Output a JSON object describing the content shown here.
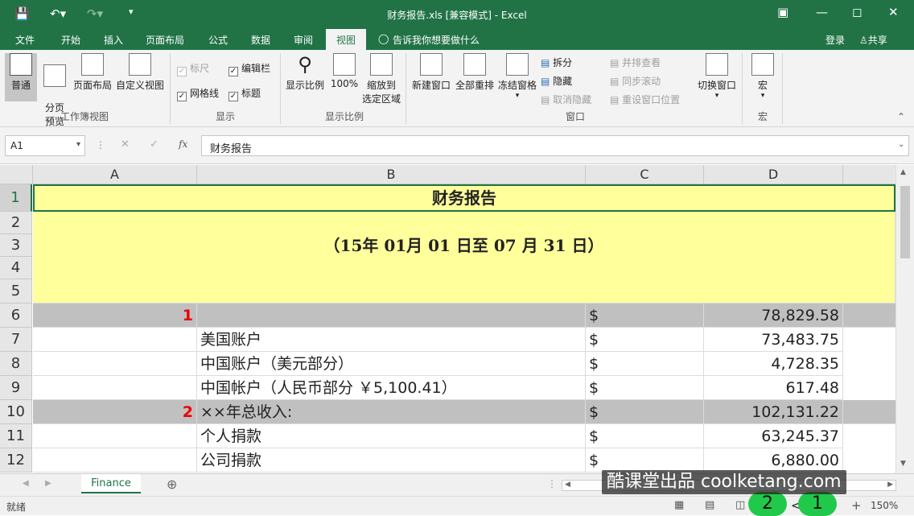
{
  "window": {
    "title": "财务报告.xls [兼容模式] - Excel",
    "qat": {
      "save_icon": "save-icon",
      "undo_icon": "undo-icon",
      "redo_icon": "redo-icon",
      "customize_icon": "customize-icon"
    },
    "controls": [
      "restore-ribbon-icon",
      "minimize-icon",
      "maximize-icon",
      "close-icon"
    ]
  },
  "tabs": {
    "file": "文件",
    "home": "开始",
    "insert": "插入",
    "layout": "页面布局",
    "formulas": "公式",
    "data": "数据",
    "review": "审阅",
    "view": "视图",
    "tell_me": "告诉我你想要做什么",
    "login": "登录",
    "share": "共享"
  },
  "ribbon": {
    "workbook_views": {
      "group": "工作簿视图",
      "normal": "普通",
      "page_break": "分页\n预览",
      "page_layout": "页面布局",
      "custom": "自定义视图"
    },
    "show": {
      "group": "显示",
      "ruler": "标尺",
      "gridlines": "网格线",
      "formula_bar": "编辑栏",
      "headings": "标题"
    },
    "zoom": {
      "group": "显示比例",
      "zoom": "显示比例",
      "hundred": "100%",
      "zoom_selection_1": "缩放到",
      "zoom_selection_2": "选定区域"
    },
    "window": {
      "group": "窗口",
      "new_window": "新建窗口",
      "arrange_all": "全部重排",
      "freeze": "冻结窗格",
      "split": "拆分",
      "hide": "隐藏",
      "unhide": "取消隐藏",
      "side_by_side": "并排查看",
      "sync_scroll": "同步滚动",
      "reset_pos": "重设窗口位置",
      "switch": "切换窗口"
    },
    "macros": {
      "group": "宏",
      "macros": "宏"
    }
  },
  "formula_bar": {
    "name_box": "A1",
    "fx": "fx",
    "content": "财务报告"
  },
  "grid": {
    "columns": [
      "A",
      "B",
      "C",
      "D"
    ],
    "rows": [
      "1",
      "2",
      "3",
      "4",
      "5",
      "6",
      "7",
      "8",
      "9",
      "10",
      "11",
      "12"
    ],
    "title": "财务报告",
    "date_range": "（15年  01月  01  日至  07  月  31  日）",
    "r6": {
      "a": "1",
      "c": "$",
      "d": "78,829.58"
    },
    "r7": {
      "b": "美国账户",
      "c": "$",
      "d": "73,483.75"
    },
    "r8": {
      "b": "中国账户（美元部分）",
      "c": "$",
      "d": "4,728.35"
    },
    "r9": {
      "b": "中国帐户（人民币部分 ￥5,100.41）",
      "c": "$",
      "d": "617.48"
    },
    "r10": {
      "a": "2",
      "b": "××年总收入:",
      "c": "$",
      "d": "102,131.22"
    },
    "r11": {
      "b": "个人捐款",
      "c": "$",
      "d": "63,245.37"
    },
    "r12": {
      "b": "公司捐款",
      "c": "$",
      "d": "6,880.00"
    }
  },
  "sheet_tabs": [
    "Finance"
  ],
  "status": {
    "ready": "就绪",
    "zoom": "150%",
    "badge_left": "2",
    "badge_right": "1",
    "badge_arrow": "<"
  },
  "watermark": "酷课堂出品 coolketang.com"
}
